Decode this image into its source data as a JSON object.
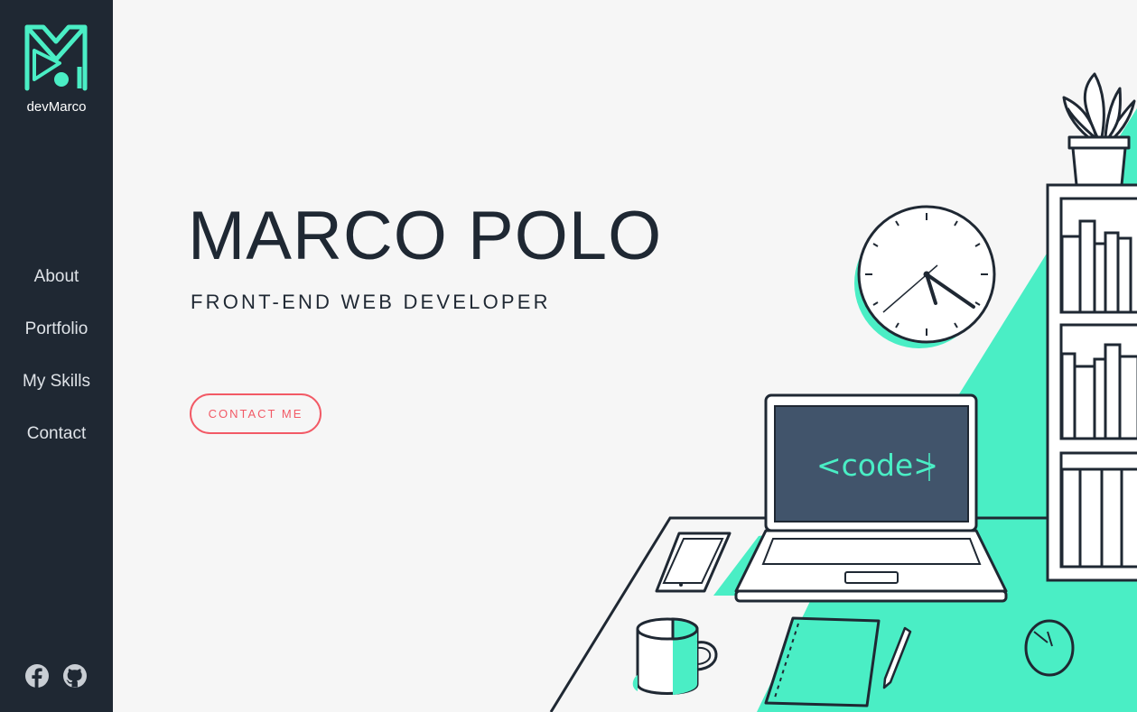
{
  "sidebar": {
    "brand": "devMarco",
    "logo_icon": "m-monogram-logo",
    "nav": [
      {
        "label": "About"
      },
      {
        "label": "Portfolio"
      },
      {
        "label": "My Skills"
      },
      {
        "label": "Contact"
      }
    ],
    "social": [
      {
        "icon": "facebook-icon"
      },
      {
        "icon": "github-icon"
      }
    ]
  },
  "hero": {
    "name": "MARCO POLO",
    "subtitle": "FRONT-END WEB DEVELOPER",
    "cta_label": "CONTACT ME"
  },
  "illustration": {
    "screen_text": "<code>"
  },
  "colors": {
    "sidebar_bg": "#1f2833",
    "accent": "#4aeec5",
    "cta": "#f25a66",
    "page_bg": "#f6f6f6",
    "text": "#1f2833"
  }
}
